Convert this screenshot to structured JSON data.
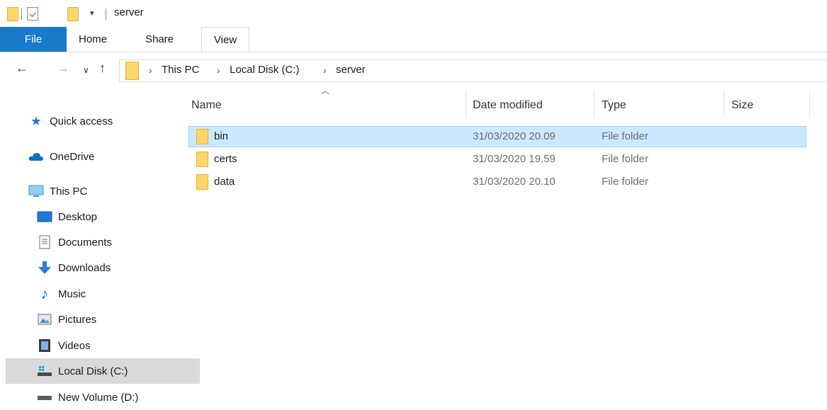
{
  "window": {
    "title": "server"
  },
  "ribbon": {
    "file_label": "File",
    "tabs": [
      "Home",
      "Share",
      "View"
    ],
    "active_tab": "View"
  },
  "address": {
    "breadcrumbs": [
      "This PC",
      "Local Disk (C:)",
      "server"
    ]
  },
  "sidebar": {
    "items": [
      {
        "label": "Quick access",
        "icon": "star-icon"
      },
      {
        "label": "OneDrive",
        "icon": "cloud-icon"
      },
      {
        "label": "This PC",
        "icon": "monitor-icon"
      },
      {
        "label": "Desktop",
        "icon": "desktop-icon"
      },
      {
        "label": "Documents",
        "icon": "document-icon"
      },
      {
        "label": "Downloads",
        "icon": "download-arrow-icon"
      },
      {
        "label": "Music",
        "icon": "music-note-icon"
      },
      {
        "label": "Pictures",
        "icon": "picture-icon"
      },
      {
        "label": "Videos",
        "icon": "film-icon"
      },
      {
        "label": "Local Disk (C:)",
        "icon": "drive-icon",
        "selected": true
      },
      {
        "label": "New Volume (D:)",
        "icon": "drive-icon"
      }
    ]
  },
  "columns": {
    "name": "Name",
    "date": "Date modified",
    "type": "Type",
    "size": "Size"
  },
  "files": [
    {
      "name": "bin",
      "date": "31/03/2020 20.09",
      "type": "File folder",
      "size": "",
      "selected": true
    },
    {
      "name": "certs",
      "date": "31/03/2020 19.59",
      "type": "File folder",
      "size": ""
    },
    {
      "name": "data",
      "date": "31/03/2020 20.10",
      "type": "File folder",
      "size": ""
    }
  ],
  "colors": {
    "accent": "#1979ca",
    "selection": "#cce8ff",
    "folder": "#fcd56b"
  }
}
